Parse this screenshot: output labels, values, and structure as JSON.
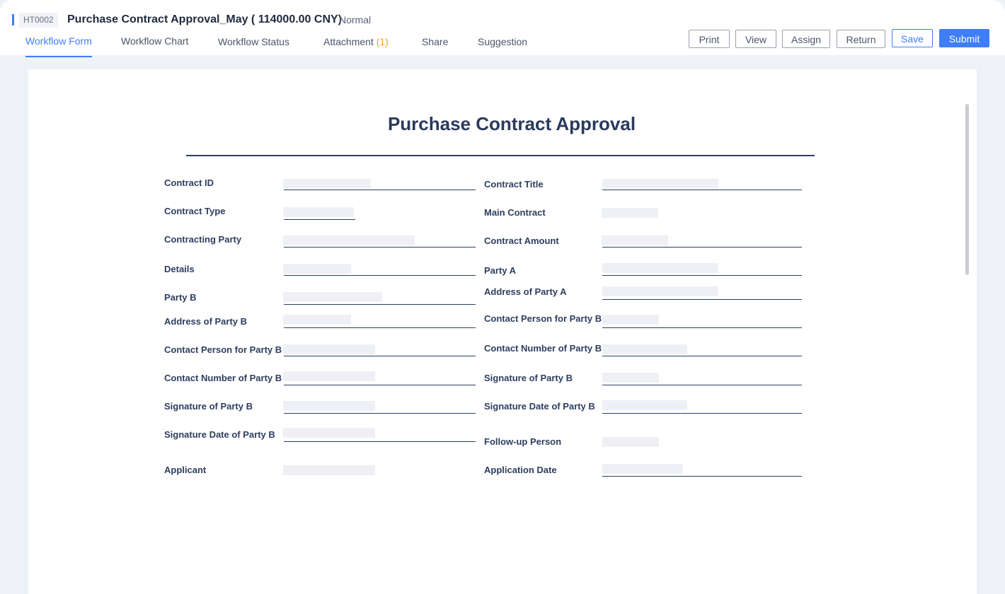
{
  "header": {
    "code": "HT0002",
    "title": "Purchase Contract Approval_May ( 114000.00 CNY)",
    "priority": "Normal"
  },
  "tabs": [
    {
      "label": "Workflow Form",
      "count": "",
      "active": true
    },
    {
      "label": "Workflow Chart",
      "count": ""
    },
    {
      "label": "Workflow Status",
      "count": ""
    },
    {
      "label": "Attachment ",
      "count": "(1)"
    },
    {
      "label": "Share",
      "count": ""
    },
    {
      "label": "Suggestion",
      "count": ""
    }
  ],
  "toolbar": {
    "print": "Print",
    "view": "View",
    "assign": "Assign",
    "return": "Return",
    "save": "Save",
    "submit": "Submit"
  },
  "form": {
    "title": "Purchase Contract Approval",
    "left_labels": [
      "Contract ID",
      "Contract Type",
      "Contracting Party",
      "Details",
      "Party B",
      "Address of Party B",
      "Contact Person for Party B",
      "Contact Number of Party B",
      "Signature of Party B",
      "Signature Date of Party B",
      "Applicant"
    ],
    "right_labels": [
      "Contract Title",
      "Main Contract",
      "Contract Amount",
      "Party A",
      "Address of Party A",
      "Contact Person for Party B",
      "Contact Number of Party B",
      "Signature of Party B",
      "Signature Date of Party B",
      "Follow-up Person",
      "Application Date"
    ]
  },
  "colors": {
    "accent": "#3f7ef7",
    "attachment_count": "#f0a020",
    "label_text": "#2d3e5f",
    "background": "#eef1f6"
  }
}
